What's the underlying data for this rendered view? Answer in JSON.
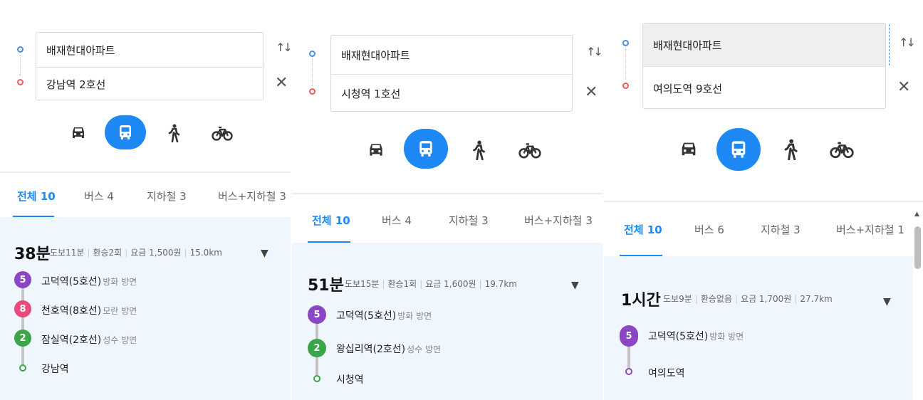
{
  "panels": [
    {
      "origin": "배재현대아파트",
      "destination": "강남역 2호선",
      "tabs": [
        "전체 10",
        "버스 4",
        "지하철 3",
        "버스+지하철 3"
      ],
      "result": {
        "duration": "38분",
        "walk": "도보11분",
        "transfer": "환승2회",
        "fare": "요금 1,500원",
        "distance": "15.0km",
        "dropdown": "▼",
        "stops": [
          {
            "badge": "5",
            "name": "고덕역(5호선)",
            "dir": "방화 방면"
          },
          {
            "badge": "8",
            "name": "천호역(8호선)",
            "dir": "모란 방면"
          },
          {
            "badge": "2",
            "name": "잠실역(2호선)",
            "dir": "성수 방면"
          },
          {
            "badge": "",
            "name": "강남역",
            "dir": ""
          }
        ]
      }
    },
    {
      "origin": "배재현대아파트",
      "destination": "시청역 1호선",
      "tabs": [
        "전체 10",
        "버스 4",
        "지하철 3",
        "버스+지하철 3"
      ],
      "result": {
        "duration": "51분",
        "walk": "도보15분",
        "transfer": "환승1회",
        "fare": "요금 1,600원",
        "distance": "19.7km",
        "dropdown": "▼",
        "stops": [
          {
            "badge": "5",
            "name": "고덕역(5호선)",
            "dir": "방화 방면"
          },
          {
            "badge": "2",
            "name": "왕십리역(2호선)",
            "dir": "성수 방면"
          },
          {
            "badge": "",
            "name": "시청역",
            "dir": ""
          }
        ]
      }
    },
    {
      "origin": "배재현대아파트",
      "destination": "여의도역 9호선",
      "tabs": [
        "전체 10",
        "버스 6",
        "지하철 3",
        "버스+지하철 1"
      ],
      "result": {
        "duration": "1시간",
        "walk": "도보9분",
        "transfer": "환승없음",
        "fare": "요금 1,700원",
        "distance": "27.7km",
        "dropdown": "▼",
        "stops": [
          {
            "badge": "5",
            "name": "고덕역(5호선)",
            "dir": "방화 방면"
          },
          {
            "badge": "",
            "name": "여의도역",
            "dir": ""
          }
        ]
      }
    }
  ],
  "icons": {
    "swap": "swap-icon",
    "close": "close-icon",
    "modes": [
      "car-icon",
      "bus-icon",
      "walk-icon",
      "bike-icon"
    ]
  },
  "colors": {
    "accent": "#1e88f5",
    "line5": "#8b46c4",
    "line8": "#e84c7d",
    "line2": "#3aa648",
    "result_bg": "#f0f6fd"
  }
}
